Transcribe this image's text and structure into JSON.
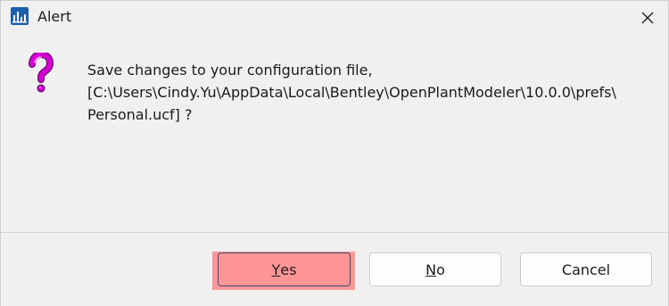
{
  "window": {
    "title": "Alert",
    "icon": "app-chart-icon",
    "close_icon": "close-icon"
  },
  "message": {
    "icon": "question-mark-icon",
    "icon_color": "#cc00cc",
    "text": "Save changes to your configuration file,\n[C:\\Users\\Cindy.Yu\\AppData\\Local\\Bentley\\OpenPlantModeler\\10.0.0\\prefs\\\nPersonal.ucf] ?"
  },
  "buttons": {
    "yes": {
      "mnemonic": "Y",
      "rest": "es",
      "background": "#ff9696"
    },
    "no": {
      "mnemonic": "N",
      "rest": "o"
    },
    "cancel": {
      "label": "Cancel"
    }
  },
  "colors": {
    "app_icon": "#1d5fa8",
    "highlight": "#ff9696",
    "window_bg": "#f0f0f0"
  }
}
